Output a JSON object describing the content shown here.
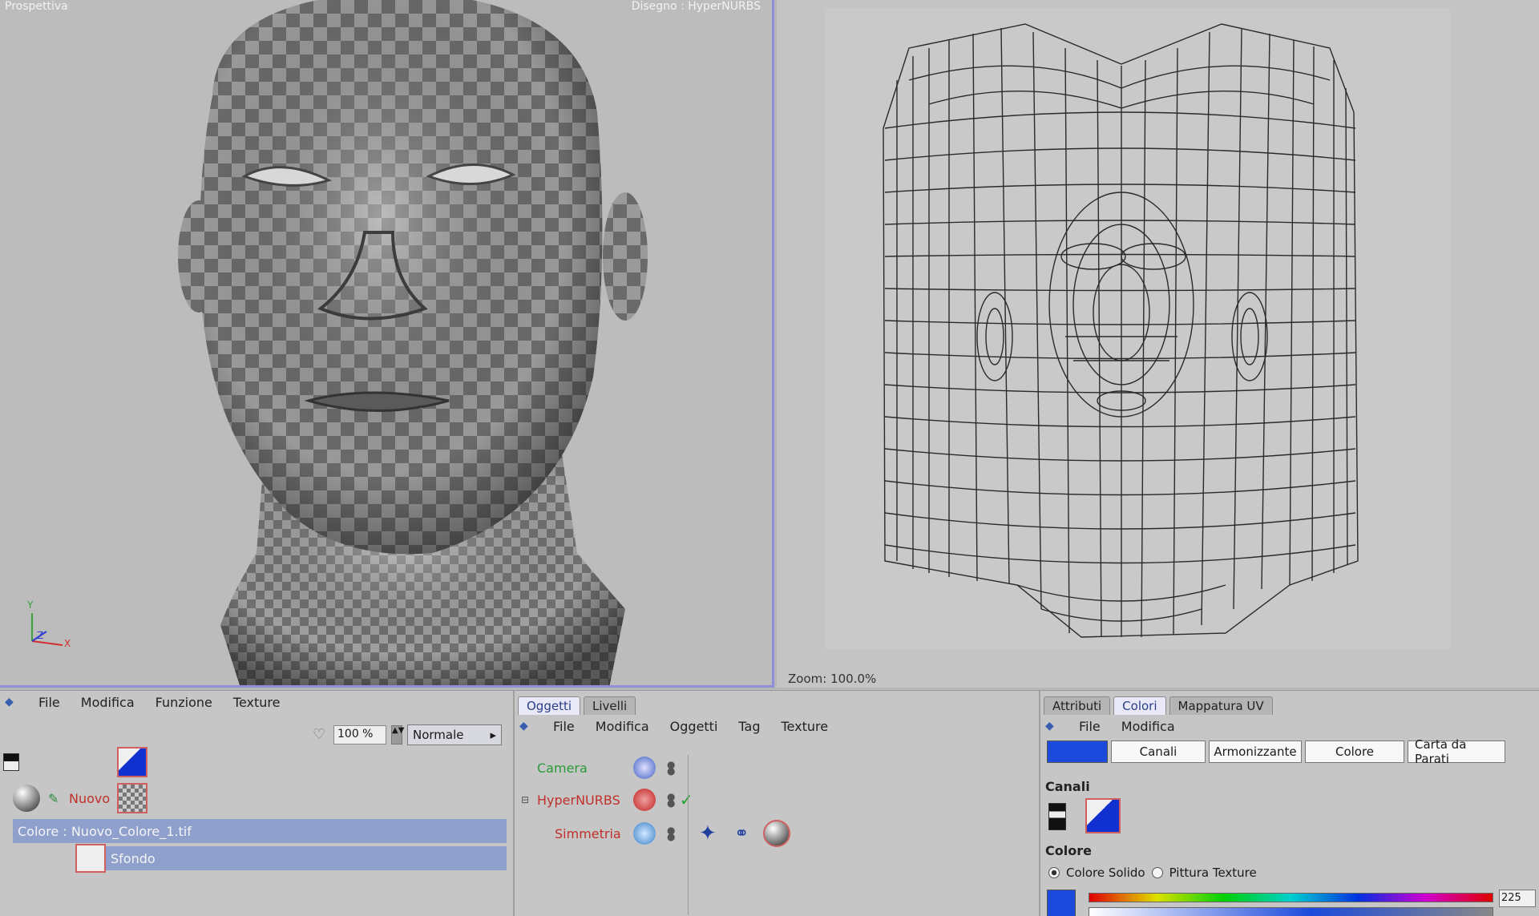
{
  "viewport_3d": {
    "title": "Prospettiva",
    "status": "Disegno : HyperNURBS",
    "axis_labels": {
      "y": "Y",
      "z": "Z",
      "x": "X"
    }
  },
  "viewport_uv": {
    "zoom_label": "Zoom: 100.0%"
  },
  "material_panel": {
    "menu": [
      "File",
      "Modifica",
      "Funzione",
      "Texture"
    ],
    "zoom_value": "100 %",
    "mode_value": "Normale",
    "mode_arrow": "▸",
    "material_name": "Nuovo",
    "selected_row": "Colore : Nuovo_Colore_1.tif",
    "layer_name": "Sfondo"
  },
  "objects_panel": {
    "tabs": [
      "Oggetti",
      "Livelli"
    ],
    "active_tab": "Oggetti",
    "menu": [
      "File",
      "Modifica",
      "Oggetti",
      "Tag",
      "Texture"
    ],
    "objects": [
      {
        "name": "Camera",
        "color": "green"
      },
      {
        "name": "HyperNURBS",
        "color": "red"
      },
      {
        "name": "Simmetria",
        "color": "red"
      }
    ],
    "checkmark": "✓"
  },
  "attributes_panel": {
    "tabs": [
      "Attributi",
      "Colori",
      "Mappatura UV"
    ],
    "active_tab": "Colori",
    "menu": [
      "File",
      "Modifica"
    ],
    "channel_buttons": [
      "Canali",
      "Armonizzante",
      "Colore",
      "Carta da Parati"
    ],
    "section_channels": "Canali",
    "section_color": "Colore",
    "radio_solid": "Colore Solido",
    "radio_texture": "Pittura Texture",
    "value": "225",
    "accent_color": "#1c4adc"
  }
}
